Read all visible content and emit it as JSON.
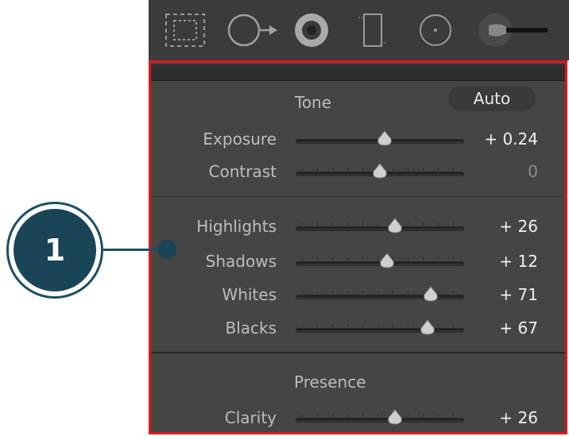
{
  "colors": {
    "highlight_border": "#e0151b",
    "panel_bg": "#454545",
    "callout": "#1a4556"
  },
  "toolbar": {
    "tools": [
      {
        "name": "crop-overlay-icon"
      },
      {
        "name": "spot-removal-icon"
      },
      {
        "name": "red-eye-icon"
      },
      {
        "name": "graduated-filter-icon"
      },
      {
        "name": "radial-filter-icon"
      },
      {
        "name": "adjustment-brush-icon"
      }
    ]
  },
  "callout": {
    "number": "1"
  },
  "tone": {
    "title": "Tone",
    "auto_label": "Auto",
    "sliders": [
      {
        "label": "Exposure",
        "value": "+ 0.24",
        "position": 0.53
      },
      {
        "label": "Contrast",
        "value": "0",
        "position": 0.5
      }
    ]
  },
  "tone_adjust": {
    "sliders": [
      {
        "label": "Highlights",
        "value": "+ 26",
        "position": 0.6
      },
      {
        "label": "Shadows",
        "value": "+ 12",
        "position": 0.55
      },
      {
        "label": "Whites",
        "value": "+ 71",
        "position": 0.84
      },
      {
        "label": "Blacks",
        "value": "+ 67",
        "position": 0.82
      }
    ]
  },
  "presence": {
    "title": "Presence",
    "sliders": [
      {
        "label": "Clarity",
        "value": "+ 26",
        "position": 0.6
      }
    ]
  }
}
